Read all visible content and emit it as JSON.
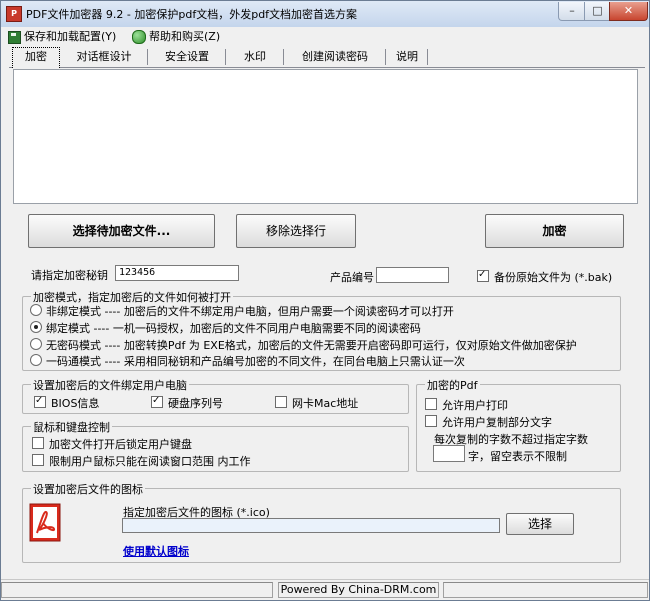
{
  "window": {
    "title": "PDF文件加密器 9.2 - 加密保护pdf文档，外发pdf文档加密首选方案",
    "controls": {
      "minimize": "–",
      "maximize": "□",
      "close": "✕"
    }
  },
  "menu": {
    "items": [
      "保存和加载配置(Y)",
      "帮助和购买(Z)"
    ]
  },
  "tabs": [
    "加密",
    "对话框设计",
    "安全设置",
    "水印",
    "创建阅读密码",
    "说明"
  ],
  "actions": {
    "select_files": "选择待加密文件...",
    "remove_selected": "移除选择行",
    "encrypt": "加密"
  },
  "key": {
    "label": "请指定加密秘钥",
    "value": "123456"
  },
  "product": {
    "label": "产品编号",
    "value": ""
  },
  "backup": {
    "label": "备份原始文件为 (*.bak)",
    "checked": true
  },
  "mode": {
    "title": "加密模式，指定加密后的文件如何被打开",
    "options": [
      {
        "label": "非绑定模式 ---- 加密后的文件不绑定用户电脑，但用户需要一个阅读密码才可以打开",
        "selected": false
      },
      {
        "label": "绑定模式 ---- 一机一码授权，加密后的文件不同用户电脑需要不同的阅读密码",
        "selected": true
      },
      {
        "label": "无密码模式 ---- 加密转换Pdf 为 EXE格式，加密后的文件无需要开启密码即可运行，仅对原始文件做加密保护",
        "selected": false
      },
      {
        "label": "一码通模式 ---- 采用相同秘钥和产品编号加密的不同文件，在同台电脑上只需认证一次",
        "selected": false
      }
    ]
  },
  "bind": {
    "title": "设置加密后的文件绑定用户电脑",
    "options": [
      {
        "label": "BIOS信息",
        "checked": true
      },
      {
        "label": "硬盘序列号",
        "checked": true
      },
      {
        "label": "网卡Mac地址",
        "checked": false
      }
    ]
  },
  "input_control": {
    "title": "鼠标和键盘控制",
    "options": [
      {
        "label": "加密文件打开后锁定用户键盘",
        "checked": false
      },
      {
        "label": "限制用户鼠标只能在阅读窗口范围 内工作",
        "checked": false
      }
    ]
  },
  "pdf_options": {
    "title": "加密的Pdf",
    "allow_print": {
      "label": "允许用户打印",
      "checked": false
    },
    "allow_copy": {
      "label": "允许用户复制部分文字",
      "checked": false
    },
    "copy_limit_line1": "每次复制的字数不超过指定字数",
    "copy_limit_value": "",
    "copy_limit_line2": "字，留空表示不限制"
  },
  "icon_settings": {
    "title": "设置加密后文件的图标",
    "field_label": "指定加密后文件的图标 (*.ico)",
    "path_value": "",
    "choose_button": "选择",
    "default_link": "使用默认图标"
  },
  "status": {
    "text": "Powered By China-DRM.com"
  }
}
